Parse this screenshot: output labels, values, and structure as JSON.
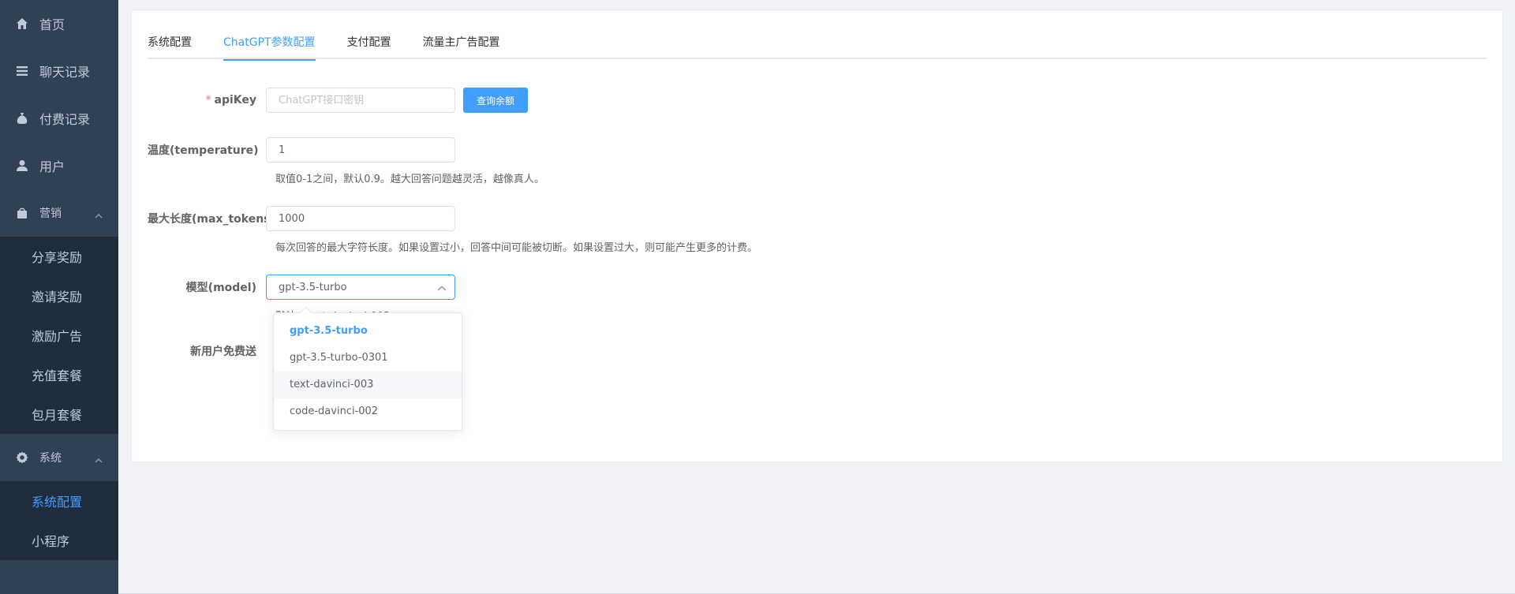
{
  "sidebar": {
    "items": [
      {
        "label": "首页",
        "icon": "home-icon"
      },
      {
        "label": "聊天记录",
        "icon": "list-icon"
      },
      {
        "label": "付费记录",
        "icon": "money-bag-icon"
      },
      {
        "label": "用户",
        "icon": "user-icon"
      }
    ],
    "marketing": {
      "label": "营销",
      "icon": "shopping-bag-icon",
      "children": [
        "分享奖励",
        "邀请奖励",
        "激励广告",
        "充值套餐",
        "包月套餐"
      ]
    },
    "system": {
      "label": "系统",
      "icon": "gear-icon",
      "children": [
        "系统配置",
        "小程序"
      ],
      "active_child": "系统配置"
    }
  },
  "tabs": [
    "系统配置",
    "ChatGPT参数配置",
    "支付配置",
    "流量主广告配置"
  ],
  "active_tab": "ChatGPT参数配置",
  "form": {
    "apikey": {
      "label": "apiKey",
      "required_mark": "*",
      "value": "",
      "placeholder": "ChatGPT接口密钥",
      "button": "查询余额"
    },
    "temperature": {
      "label": "温度(temperature)",
      "value": "1",
      "hint": "取值0-1之间，默认0.9。越大回答问题越灵活，越像真人。"
    },
    "max_tokens": {
      "label": "最大长度(max_tokens)",
      "value": "1000",
      "hint": "每次回答的最大字符长度。如果设置过小，回答中间可能被切断。如果设置过大，则可能产生更多的计费。"
    },
    "model": {
      "label": "模型(model)",
      "value": "gpt-3.5-turbo",
      "hint": "默认：text-davinci-003"
    },
    "new_user": {
      "label": "新用户免费送"
    }
  },
  "dropdown": {
    "options": [
      "gpt-3.5-turbo",
      "gpt-3.5-turbo-0301",
      "text-davinci-003",
      "code-davinci-002"
    ],
    "selected": "gpt-3.5-turbo",
    "hovered": "text-davinci-003"
  },
  "colors": {
    "accent": "#409eff",
    "sidebar_bg": "#304156",
    "submenu_bg": "#1f2d3d",
    "required": "#f56c6c"
  }
}
